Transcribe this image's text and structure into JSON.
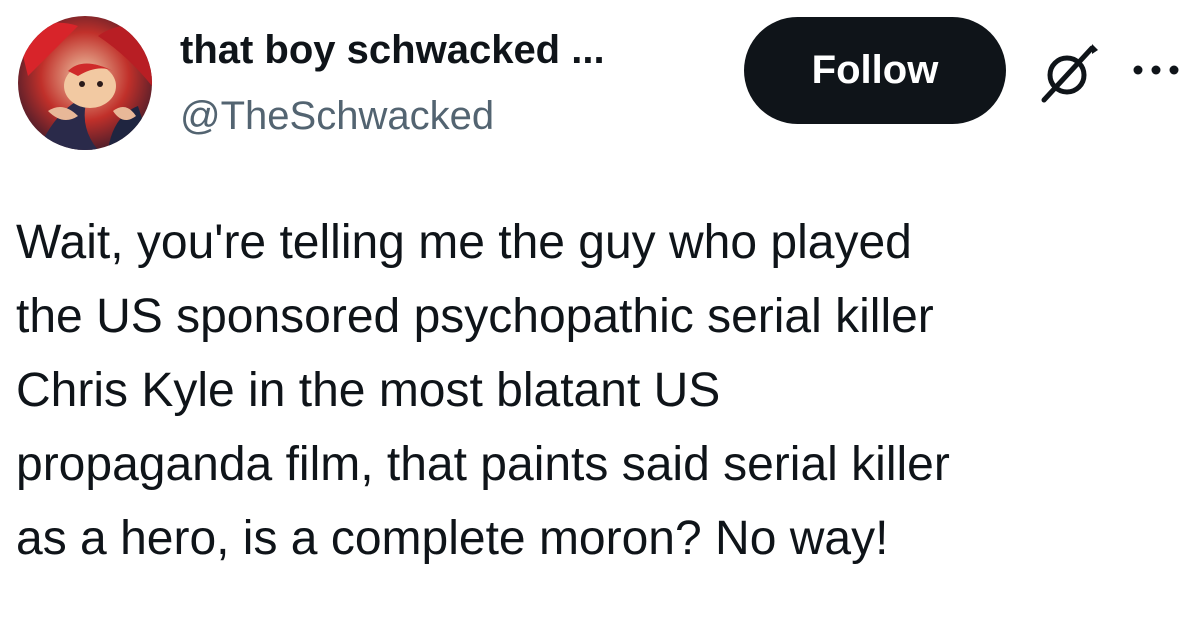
{
  "author": {
    "display_name": "that boy schwacked ...",
    "handle": "@TheSchwacked",
    "avatar_icon": "anime-character-avatar"
  },
  "actions": {
    "follow_label": "Follow",
    "grok_icon": "grok-icon",
    "more_icon": "more-options-icon"
  },
  "tweet": {
    "lines": [
      "Wait, you're telling me the guy who played",
      "the US sponsored psychopathic serial killer",
      "Chris Kyle in the most blatant US",
      "propaganda film, that paints said serial killer",
      "as a hero, is a complete moron? No way!"
    ]
  },
  "colors": {
    "text": "#0f1419",
    "secondary_text": "#536471",
    "button_bg": "#0f1419",
    "button_text": "#ffffff",
    "background": "#ffffff"
  }
}
